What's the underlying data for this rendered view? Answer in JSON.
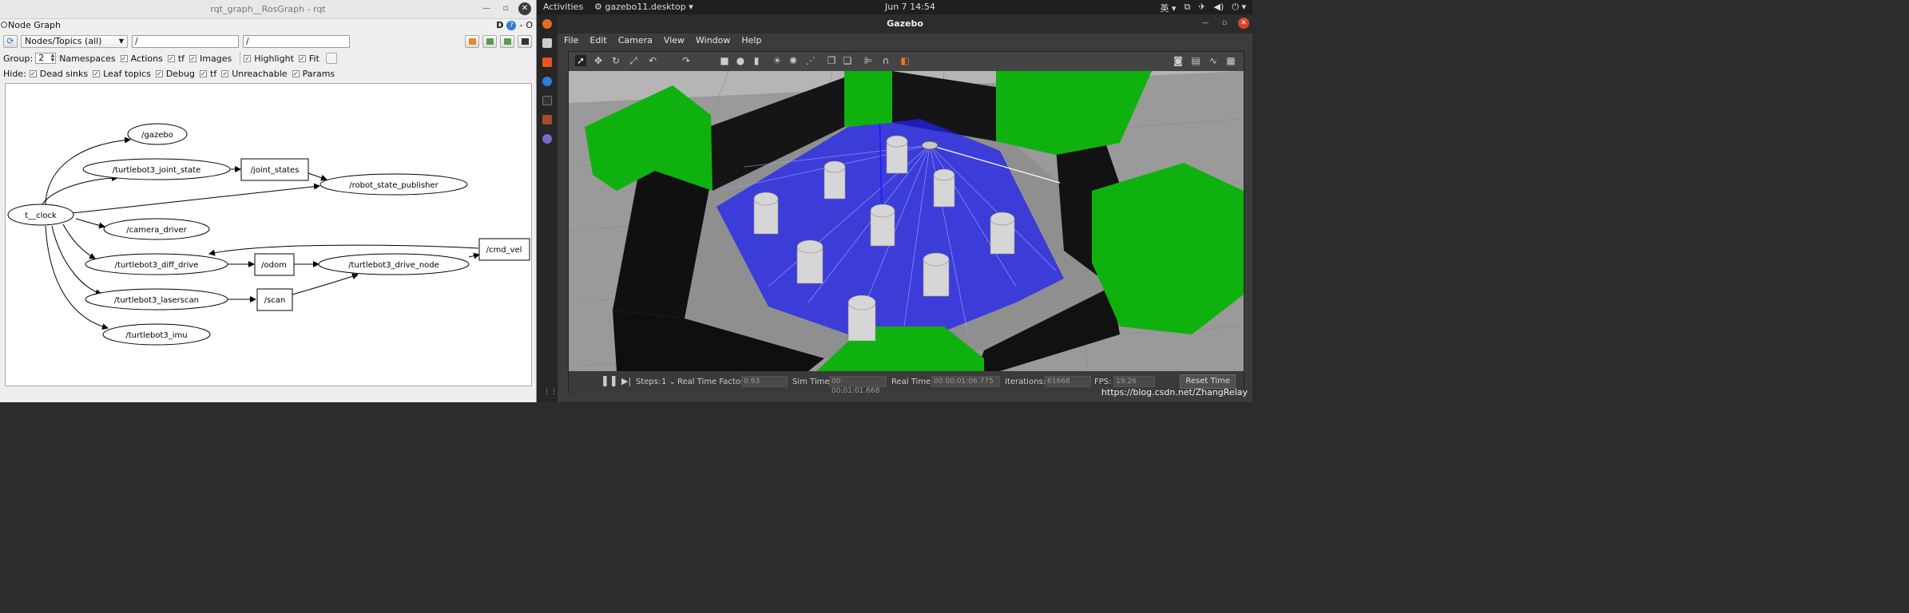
{
  "rqt": {
    "window_title": "rqt_graph__RosGraph - rqt",
    "plugin_title": "Node Graph",
    "plugin_badges": {
      "d": "D",
      "help": "?",
      "dash": "-",
      "o": "O"
    },
    "graph_type": "Nodes/Topics (all)",
    "filter1": "/",
    "filter2": "/",
    "group_label": "Group:",
    "group_value": "2",
    "options": [
      {
        "label": "Namespaces",
        "checked": false
      },
      {
        "label": "Actions",
        "checked": true
      },
      {
        "label": "tf",
        "checked": true
      },
      {
        "label": "Images",
        "checked": true
      }
    ],
    "highlight": {
      "label": "Highlight",
      "checked": true
    },
    "fit": {
      "label": "Fit",
      "checked": true
    },
    "hide_label": "Hide:",
    "hide_options": [
      {
        "label": "Dead sinks",
        "checked": true
      },
      {
        "label": "Leaf topics",
        "checked": true
      },
      {
        "label": "Debug",
        "checked": true
      },
      {
        "label": "tf",
        "checked": true
      },
      {
        "label": "Unreachable",
        "checked": true
      },
      {
        "label": "Params",
        "checked": true
      }
    ],
    "graph": {
      "nodes": {
        "clock": "t__clock",
        "gazebo": "/gazebo",
        "joint_state_node": "/turtlebot3_joint_state",
        "joint_states_topic": "/joint_states",
        "rsp": "/robot_state_publisher",
        "camera": "/camera_driver",
        "diff_drive": "/turtlebot3_diff_drive",
        "odom": "/odom",
        "drive_node": "/turtlebot3_drive_node",
        "cmd_vel": "/cmd_vel",
        "laserscan": "/turtlebot3_laserscan",
        "scan": "/scan",
        "imu": "/turtlebot3_imu"
      }
    }
  },
  "desktop": {
    "activities": "Activities",
    "app_name": "gazebo11.desktop",
    "clock": "Jun 7  14:54",
    "ime": "英"
  },
  "gazebo": {
    "window_title": "Gazebo",
    "menu": [
      "File",
      "Edit",
      "Camera",
      "View",
      "Window",
      "Help"
    ],
    "bottom": {
      "steps_label": "Steps:",
      "steps_value": "1",
      "rtf_label": "Real Time Factor:",
      "rtf_value": "0.93",
      "sim_label": "Sim Time:",
      "sim_value": "00 00:01:01.668",
      "real_label": "Real Time:",
      "real_value": "00 00:01:06.775",
      "iter_label": "Iterations:",
      "iter_value": "61668",
      "fps_label": "FPS:",
      "fps_value": "19.26",
      "reset_label": "Reset Time"
    },
    "watermark": "https://blog.csdn.net/ZhangRelay"
  },
  "colors": {
    "green_wall": "#0fb10f",
    "laser": "#2a2aff",
    "ground": "#9a9a9a"
  }
}
